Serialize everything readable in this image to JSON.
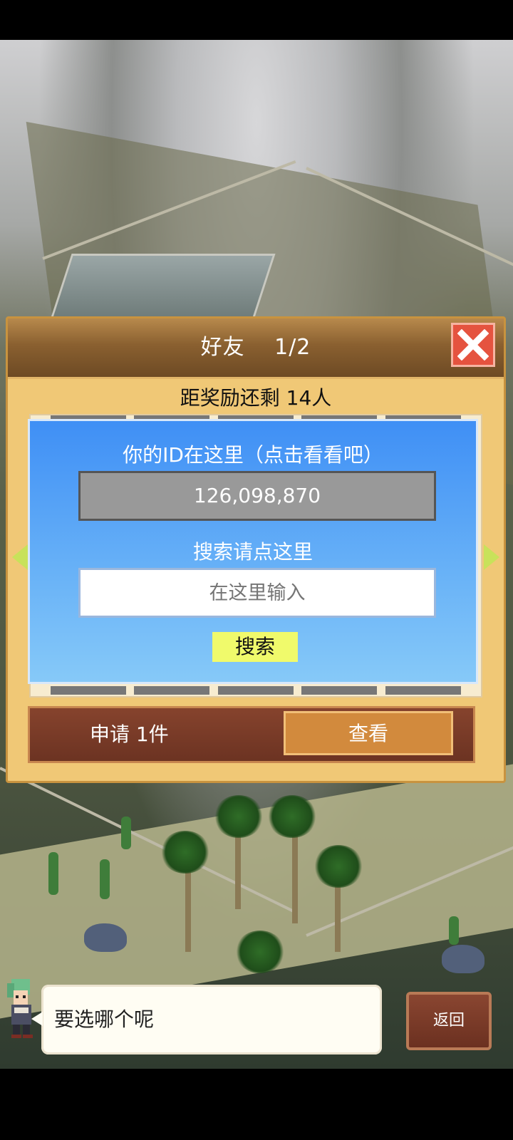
{
  "dialog": {
    "title": "好友　 1/2",
    "reward_progress": "距奖励还剩 14人",
    "close_icon": "close-x-icon"
  },
  "id_panel": {
    "id_hint": "你的ID在这里（点击看看吧）",
    "player_id": "126,098,870",
    "search_hint": "搜索请点这里",
    "search_placeholder": "在这里输入",
    "search_button": "搜索"
  },
  "requests": {
    "text": "申请 1件",
    "view_button": "查看"
  },
  "footer": {
    "speech": "要选哪个呢",
    "back_button": "返回"
  },
  "colors": {
    "panel_blue": "#3f8ff5",
    "close_red": "#e5533f",
    "search_yellow": "#f0fa6b",
    "view_orange": "#d28a3d"
  }
}
